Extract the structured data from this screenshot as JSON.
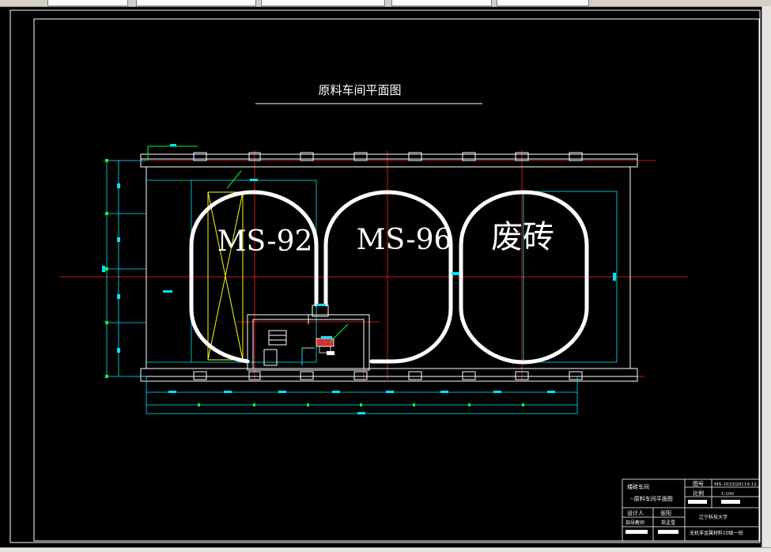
{
  "drawing": {
    "title": "原料车间平面图",
    "loop_labels": [
      "MS-92",
      "MS-96",
      "废砖"
    ]
  },
  "title_block": {
    "project_line1": "矮砖车间",
    "project_line2": "--原料车间平面图",
    "label_drawing_no": "图号",
    "drawing_no": "MS-1033/20119-12",
    "label_scale": "比例",
    "scale": "1:100",
    "label_designer": "设计人",
    "designer_value": "张阳",
    "label_advisor": "指导教师",
    "advisor_value": "郑孟雪",
    "school": "辽宁科技大学",
    "class_name": "无机非金属材料10级一班"
  },
  "colors": {
    "background": "#000000",
    "frame": "#ffffff",
    "wall": "#ffffff",
    "axis": "#ff0000",
    "dimension": "#00e5ff",
    "dimension_tick": "#00ff33",
    "rail": "#ffffff",
    "highlight": "#ffff00"
  }
}
